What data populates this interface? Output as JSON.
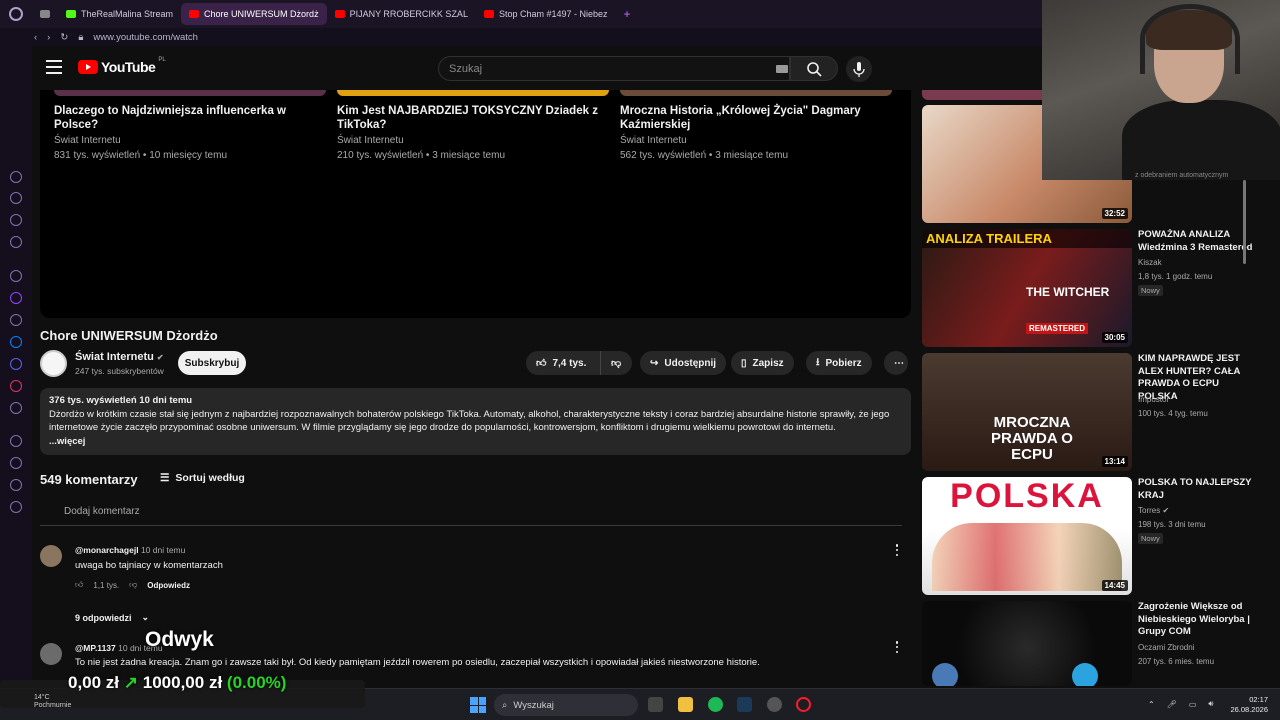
{
  "browser": {
    "tabs": [
      {
        "label": "",
        "fav": "#888"
      },
      {
        "label": "TheRealMalina Stream",
        "fav": "#53fc18"
      },
      {
        "label": "Chore UNIWERSUM Dżordż",
        "fav": "#ff0000",
        "active": true
      },
      {
        "label": "PIJANY RROBERCIKK SZAL",
        "fav": "#ff0000"
      },
      {
        "label": "Stop Cham #1497 - Niebez",
        "fav": "#ff0000"
      }
    ],
    "new_tab": "+",
    "url": "www.youtube.com/watch"
  },
  "yt": {
    "logo": "YouTube",
    "logo_region": "PL",
    "search_placeholder": "Szukaj",
    "top_videos": [
      {
        "title": "Dlaczego to Najdziwniejsza influencerka w Polsce?",
        "channel": "Świat Internetu",
        "meta": "831 tys. wyświetleń • 10 miesięcy temu",
        "thumb": "#5a2f4a"
      },
      {
        "title": "Kim Jest NAJBARDZIEJ TOKSYCZNY Dziadek z TikToka?",
        "channel": "Świat Internetu",
        "meta": "210 tys. wyświetleń • 3 miesiące temu",
        "thumb": "#e0a010"
      },
      {
        "title": "Mroczna Historia „Królowej Życia\" Dagmary Kaźmierskiej",
        "channel": "Świat Internetu",
        "meta": "562 tys. wyświetleń • 3 miesiące temu",
        "thumb": "#6b4c3a"
      }
    ],
    "video_title": "Chore UNIWERSUM Dżordżo",
    "channel": {
      "name": "Świat Internetu",
      "subs": "247 tys. subskrybentów",
      "verified": "✔"
    },
    "subscribe": "Subskrybuj",
    "actions": {
      "likes": "7,4 tys.",
      "share": "Udostępnij",
      "save": "Zapisz",
      "download": "Pobierz"
    },
    "description": {
      "stats": "376 tys. wyświetleń  10 dni temu",
      "text": "Dżordżo w krótkim czasie stał się jednym z najbardziej rozpoznawalnych bohaterów polskiego TikToka. Automaty, alkohol, charakterystyczne teksty i coraz bardziej absurdalne historie sprawiły, że jego internetowe życie zaczęło przypominać osobne uniwersum. W filmie przyglądamy się jego drodze do popularności, kontrowersjom, konfliktom i drugiemu wielkiemu powrotowi do internetu.",
      "more": "...więcej"
    },
    "comments_count": "549 komentarzy",
    "sort": "Sortuj według",
    "add_comment": "Dodaj komentarz",
    "comments": [
      {
        "author": "@monarchagejl",
        "time": "10 dni temu",
        "text": "uwaga bo tajniacy w komentarzach",
        "likes": "1,1 tys.",
        "reply": "Odpowiedz",
        "replies": "9 odpowiedzi"
      },
      {
        "author": "@MP.1137",
        "time": "10 dni temu",
        "text": "To nie jest żadna kreacja. Znam go i zawsze taki był. Od kiedy pamiętam jeździł rowerem po osiedlu, zaczepiał wszystkich i opowiadał jakieś niestworzone historie."
      }
    ],
    "related": [
      {
        "title": "",
        "channel": "",
        "meta": "",
        "duration": "",
        "badge": "",
        "thumb": "#7a3a50"
      },
      {
        "title": "",
        "channel": "",
        "meta": "",
        "duration": "32:52",
        "badge": "",
        "thumb": "#c98a6a"
      },
      {
        "title": "POWAŻNA ANALIZA Wiedźmina 3 Remastered",
        "channel": "Kiszak",
        "meta": "1,8 tys.  1 godz. temu",
        "duration": "30:05",
        "badge": "Nowy",
        "thumb": "#7a1c1c",
        "overlay": "ANALIZA TRAILERA",
        "overlay2": "THE WITCHER",
        "overlay3": "REMASTERED"
      },
      {
        "title": "KIM NAPRAWDĘ JEST ALEX HUNTER? CAŁA PRAWDA O ECPU POLSKA",
        "channel": "Impostor",
        "meta": "100 tys.  4 tyg. temu",
        "duration": "13:14",
        "badge": "",
        "thumb": "#3a2a22",
        "overlay": "MROCZNA PRAWDA O ECPU"
      },
      {
        "title": "POLSKA TO NAJLEPSZY KRAJ",
        "channel": "Torres",
        "meta": "198 tys.  3 dni temu",
        "duration": "14:45",
        "badge": "Nowy",
        "thumb": "#ffffff",
        "overlay": "POLSKA"
      },
      {
        "title": "Zagrożenie Większe od Niebieskiego Wieloryba | Grupy COM",
        "channel": "Oczami Zbrodni",
        "meta": "207 tys.  6 mies. temu",
        "duration": "",
        "badge": "",
        "thumb": "#1a1a1a"
      }
    ]
  },
  "overlay": {
    "label": "Odwyk",
    "money_a": "0,00 zł",
    "money_arrow": "↗",
    "money_b": "1000,00 zł",
    "money_pct": "(0.00%)",
    "weather_temp": "14°C",
    "weather_desc": "Pochmurnie"
  },
  "webcam": {
    "caption": "z odebraniem automatycznym"
  },
  "taskbar": {
    "search": "Wyszukaj",
    "time": "02:17",
    "date": "26.08.2026"
  }
}
